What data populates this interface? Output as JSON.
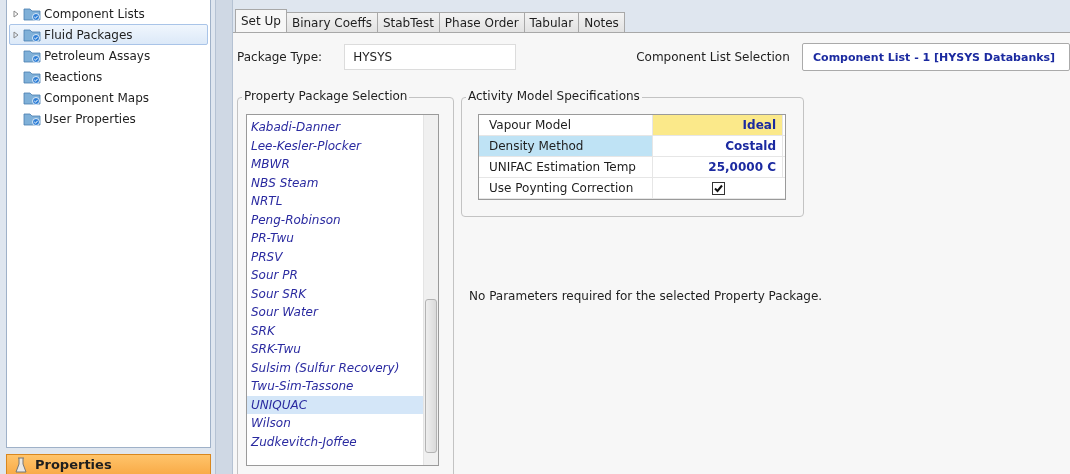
{
  "navigator": {
    "items": [
      {
        "label": "Component Lists",
        "expandable": true,
        "selected": false
      },
      {
        "label": "Fluid Packages",
        "expandable": true,
        "selected": true
      },
      {
        "label": "Petroleum Assays",
        "expandable": false,
        "selected": false
      },
      {
        "label": "Reactions",
        "expandable": false,
        "selected": false
      },
      {
        "label": "Component Maps",
        "expandable": false,
        "selected": false
      },
      {
        "label": "User Properties",
        "expandable": false,
        "selected": false
      }
    ],
    "bottom_button": "Properties"
  },
  "tabs": [
    {
      "label": "Set Up",
      "selected": true
    },
    {
      "label": "Binary Coeffs",
      "selected": false
    },
    {
      "label": "StabTest",
      "selected": false
    },
    {
      "label": "Phase Order",
      "selected": false
    },
    {
      "label": "Tabular",
      "selected": false
    },
    {
      "label": "Notes",
      "selected": false
    }
  ],
  "package_type": {
    "label": "Package Type:",
    "value": "HYSYS"
  },
  "component_list_selection": {
    "label": "Component List Selection",
    "value": "Component List - 1 [HYSYS Databanks]"
  },
  "property_package_selection": {
    "title": "Property Package Selection",
    "items": [
      {
        "label": "Kabadi-Danner",
        "selected": false
      },
      {
        "label": "Lee-Kesler-Plocker",
        "selected": false
      },
      {
        "label": "MBWR",
        "selected": false
      },
      {
        "label": "NBS Steam",
        "selected": false
      },
      {
        "label": "NRTL",
        "selected": false
      },
      {
        "label": "Peng-Robinson",
        "selected": false
      },
      {
        "label": "PR-Twu",
        "selected": false
      },
      {
        "label": "PRSV",
        "selected": false
      },
      {
        "label": "Sour PR",
        "selected": false
      },
      {
        "label": "Sour SRK",
        "selected": false
      },
      {
        "label": "Sour Water",
        "selected": false
      },
      {
        "label": "SRK",
        "selected": false
      },
      {
        "label": "SRK-Twu",
        "selected": false
      },
      {
        "label": "Sulsim (Sulfur Recovery)",
        "selected": false
      },
      {
        "label": "Twu-Sim-Tassone",
        "selected": false
      },
      {
        "label": "UNIQUAC",
        "selected": true
      },
      {
        "label": "Wilson",
        "selected": false
      },
      {
        "label": "Zudkevitch-Joffee",
        "selected": false
      }
    ]
  },
  "activity_model_specifications": {
    "title": "Activity Model Specifications",
    "rows": [
      {
        "kind": "text",
        "label": "Vapour Model",
        "value": "Ideal",
        "selected": false,
        "editing": true
      },
      {
        "kind": "text",
        "label": "Density Method",
        "value": "Costald",
        "selected": true,
        "editing": false
      },
      {
        "kind": "text",
        "label": "UNIFAC Estimation Temp",
        "value": "25,0000 C",
        "selected": false,
        "editing": false
      },
      {
        "kind": "checkbox",
        "label": "Use Poynting Correction",
        "checked": true,
        "selected": false,
        "editing": false
      }
    ]
  },
  "message": "No Parameters required for the selected Property Package."
}
